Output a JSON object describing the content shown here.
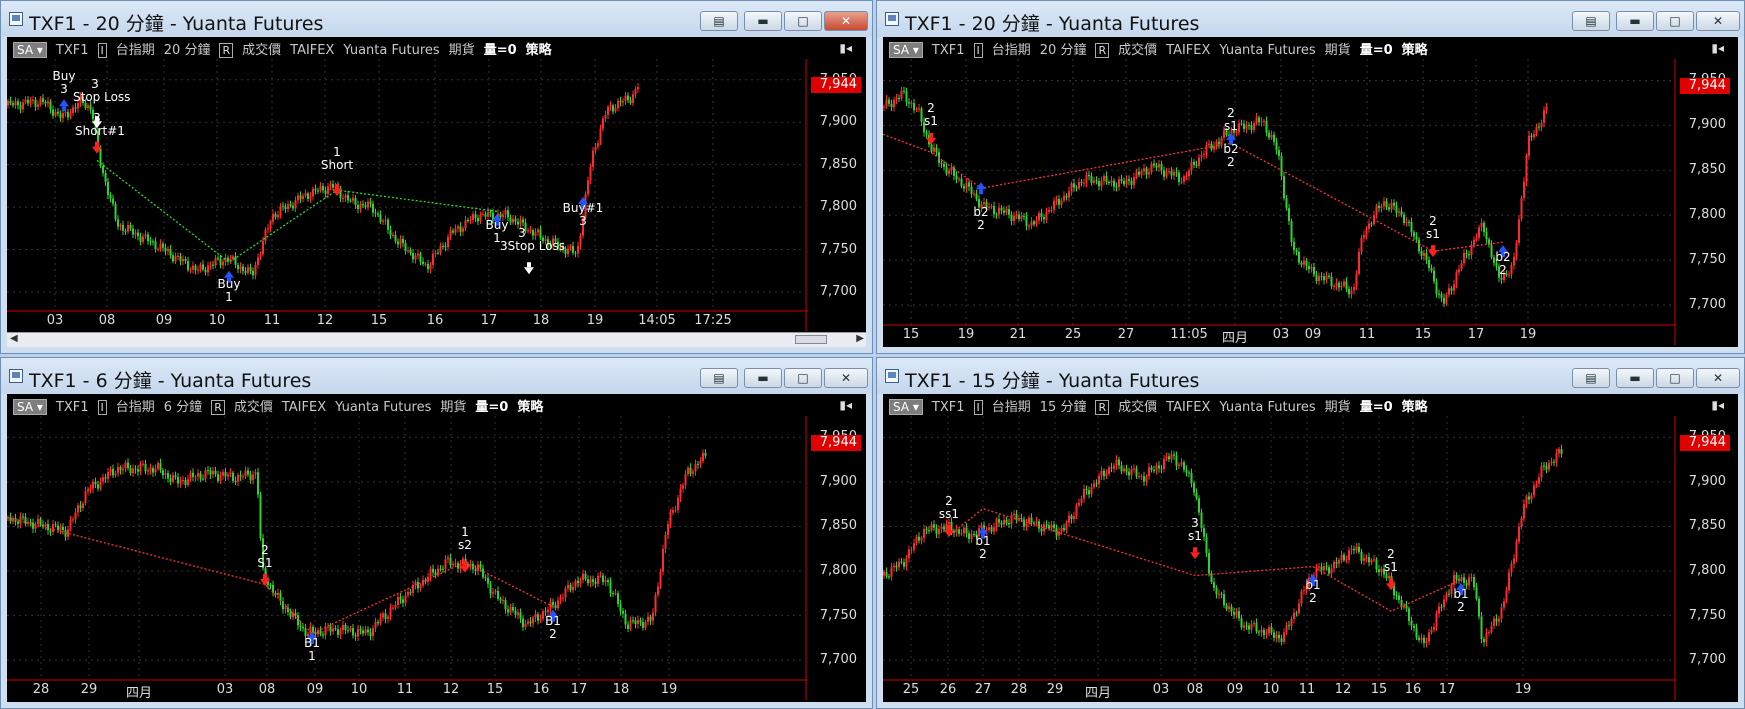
{
  "windows": [
    {
      "id": "w1",
      "title": "TXF1 - 20 分鐘 - Yuanta Futures",
      "active": true,
      "infobar": {
        "sa": "SA",
        "symbol": "TXF1",
        "i_box": "I",
        "index": "台指期",
        "period": "20 分鐘",
        "r_box": "R",
        "price_type": "成交價",
        "exchange": "TAIFEX",
        "broker": "Yuanta Futures",
        "market": "期貨",
        "volume": "量=0",
        "strategy": "策略"
      },
      "y_ticks": [
        "7,950",
        "7,900",
        "7,850",
        "7,800",
        "7,750",
        "7,700"
      ],
      "last_price": "7,944",
      "x_labels": [
        "03",
        "08",
        "09",
        "10",
        "11",
        "12",
        "15",
        "16",
        "17",
        "18",
        "19",
        "14:05",
        "17:25"
      ],
      "annotations": [
        "Buy\n3",
        "3\nStop Loss",
        "3\nShort#1",
        "1\nShort",
        "Buy\n1",
        "Buy\n1",
        "3\n3Stop Loss",
        "Buy#1\n3"
      ],
      "has_scrollbar": true,
      "colors": {
        "up": "#ff2a2a",
        "down": "#2fd32f",
        "link": "#20e020",
        "loss": "#ff3030"
      }
    },
    {
      "id": "w2",
      "title": "TXF1 - 20 分鐘 - Yuanta Futures",
      "active": false,
      "infobar": {
        "sa": "SA",
        "symbol": "TXF1",
        "i_box": "I",
        "index": "台指期",
        "period": "20 分鐘",
        "r_box": "R",
        "price_type": "成交價",
        "exchange": "TAIFEX",
        "broker": "Yuanta Futures",
        "market": "期貨",
        "volume": "量=0",
        "strategy": "策略"
      },
      "y_ticks": [
        "7,950",
        "7,900",
        "7,850",
        "7,800",
        "7,750",
        "7,700"
      ],
      "last_price": "7,944",
      "x_labels": [
        "15",
        "19",
        "21",
        "25",
        "27",
        "11:05",
        "四月",
        "03",
        "09",
        "11",
        "15",
        "17",
        "19"
      ],
      "annotations": [
        "2\ns1",
        "b2\n2",
        "2\ns1",
        "b2\n2",
        "2\ns1",
        "b2\n2"
      ],
      "has_scrollbar": false
    },
    {
      "id": "w3",
      "title": "TXF1 - 6 分鐘 - Yuanta Futures",
      "active": false,
      "infobar": {
        "sa": "SA",
        "symbol": "TXF1",
        "i_box": "I",
        "index": "台指期",
        "period": "6 分鐘",
        "r_box": "R",
        "price_type": "成交價",
        "exchange": "TAIFEX",
        "broker": "Yuanta Futures",
        "market": "期貨",
        "volume": "量=0",
        "strategy": "策略"
      },
      "y_ticks": [
        "7,950",
        "7,900",
        "7,850",
        "7,800",
        "7,750",
        "7,700"
      ],
      "last_price": "7,944",
      "x_labels": [
        "28",
        "29",
        "四月",
        "03",
        "08",
        "09",
        "10",
        "11",
        "12",
        "15",
        "16",
        "17",
        "18",
        "19"
      ],
      "annotations": [
        "2\nS1",
        "B1\n1",
        "1\ns2",
        "B1\n2"
      ],
      "has_scrollbar": false
    },
    {
      "id": "w4",
      "title": "TXF1 - 15 分鐘 - Yuanta Futures",
      "active": false,
      "infobar": {
        "sa": "SA",
        "symbol": "TXF1",
        "i_box": "I",
        "index": "台指期",
        "period": "15 分鐘",
        "r_box": "R",
        "price_type": "成交價",
        "exchange": "TAIFEX",
        "broker": "Yuanta Futures",
        "market": "期貨",
        "volume": "量=0",
        "strategy": "策略"
      },
      "y_ticks": [
        "7,950",
        "7,900",
        "7,850",
        "7,800",
        "7,750",
        "7,700"
      ],
      "last_price": "7,944",
      "x_labels": [
        "25",
        "26",
        "27",
        "28",
        "29",
        "四月",
        "03",
        "08",
        "09",
        "10",
        "11",
        "12",
        "15",
        "16",
        "17",
        "19"
      ],
      "annotations": [
        "2\nss1",
        "b1\n2",
        "3\ns1",
        "b1\n2",
        "2\ns1",
        "b1\n2"
      ],
      "has_scrollbar": false
    }
  ]
}
